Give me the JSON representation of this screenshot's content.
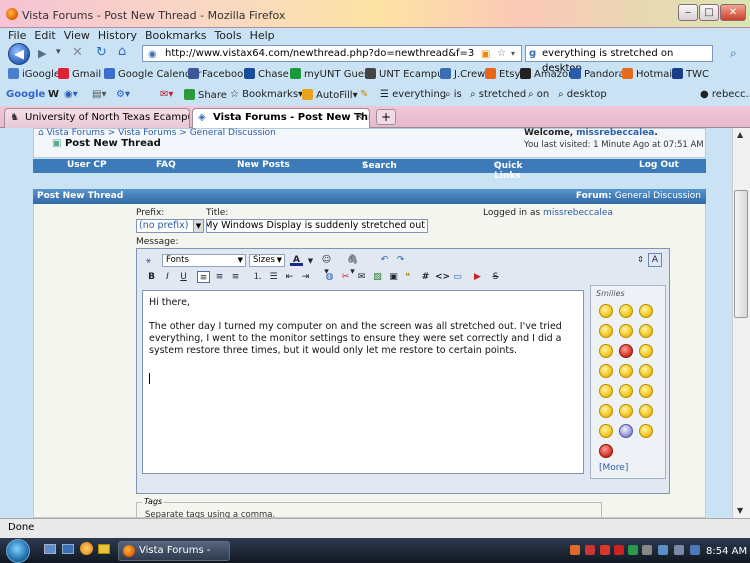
{
  "window": {
    "title": "Vista Forums - Post New Thread - Mozilla Firefox"
  },
  "menu": [
    "File",
    "Edit",
    "View",
    "History",
    "Bookmarks",
    "Tools",
    "Help"
  ],
  "address": {
    "url": "http://www.vistax64.com/newthread.php?do=newthread&f=3"
  },
  "search": {
    "value": "everything is stretched on desktop"
  },
  "bookmarks": [
    "iGoogle",
    "Gmail",
    "Google Calendar",
    "Facebook",
    "Chase",
    "myUNT Guest",
    "UNT Ecampus",
    "J.Crew",
    "Etsy",
    "Amazon",
    "Pandora",
    "Hotmail",
    "TWC"
  ],
  "google_toolbar": {
    "share": "Share",
    "bookmarks": "Bookmarks",
    "autofill": "AutoFill",
    "terms": [
      "everything",
      "is",
      "stretched",
      "on",
      "desktop"
    ],
    "user": "rebecc..."
  },
  "tabs": [
    "University of North Texas Ecampus",
    "Vista Forums - Post New Thread"
  ],
  "breadcrumb": [
    "Vista Forums",
    "Vista Forums",
    "General Discussion"
  ],
  "page_title": "Post New Thread",
  "welcome": {
    "prefix": "Welcome,",
    "user": "missrebeccalea",
    "last_visit": "You last visited: 1 Minute Ago at 07:51 AM"
  },
  "nav": [
    "User CP",
    "FAQ",
    "New Posts",
    "Search",
    "Quick Links",
    "Log Out"
  ],
  "post_header": {
    "title": "Post New Thread",
    "forum_label": "Forum:",
    "forum": "General Discussion"
  },
  "form": {
    "prefix_label": "Prefix:",
    "prefix_value": "(no prefix)",
    "title_label": "Title:",
    "title_value": "My Windows Display is suddenly stretched out",
    "logged_label": "Logged in as",
    "logged_user": "missrebeccalea",
    "message_label": "Message:"
  },
  "editor": {
    "font_select": "Fonts",
    "size_select": "Sizes",
    "smilies_title": "Smilies",
    "more": "[More]"
  },
  "message": {
    "greeting": "Hi there,",
    "body": "The other day I turned my computer on and the screen was all stretched out. I've tried everything, I went to the monitor settings to ensure they were set correctly and I did a system restore three times, but it would only let me restore to certain points."
  },
  "tags": {
    "legend": "Tags",
    "hint": "Separate tags using a comma."
  },
  "status": "Done",
  "taskbar": {
    "task": "Vista Forums - Post ...",
    "clock": "8:54 AM"
  }
}
